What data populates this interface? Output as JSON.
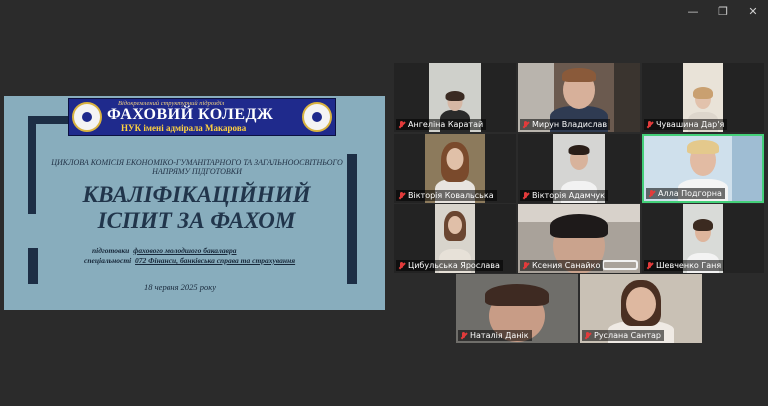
{
  "window": {
    "minimize_icon": "minimize-icon",
    "maximize_icon": "maximize-icon",
    "close_icon": "close-icon"
  },
  "slide": {
    "institution_note": "Відокремлений структурний підрозділ",
    "college_title": "ФАХОВИЙ КОЛЕДЖ",
    "university_name": "НУК імені адмірала Макарова",
    "commission": "ЦИКЛОВА КОМІСІЯ ЕКОНОМІКО-ГУМАНІТАРНОГО ТА ЗАГАЛЬНООСВІТНЬОГО НАПРЯМУ ПІДГОТОВКИ",
    "title_line1": "КВАЛІФІКАЦІЙНИЙ",
    "title_line2": "ІСПИТ ЗА ФАХОМ",
    "prep_label": "підготовки",
    "prep_value": "фахового молодшого бакалавра",
    "spec_label": "спеціальності",
    "spec_value": "072 Фінанси, банківська справа та страхування",
    "date": "18 червня 2025 року"
  },
  "participants": [
    {
      "name": "Ангеліна Каратай",
      "muted": true
    },
    {
      "name": "Мирун Владислав",
      "muted": true
    },
    {
      "name": "Чувашина Дар'я",
      "muted": true
    },
    {
      "name": "Вікторія Ковальська",
      "muted": true
    },
    {
      "name": "Вікторія Адамчук",
      "muted": true
    },
    {
      "name": "Алла Подгорна",
      "muted": true,
      "active_speaker": true
    },
    {
      "name": "Цибульська Ярослава",
      "muted": true
    },
    {
      "name": "Ксения Санайко",
      "muted": true
    },
    {
      "name": "Шевченко Ганя",
      "muted": true
    },
    {
      "name": "Наталія Данік",
      "muted": true
    },
    {
      "name": "Руслана Сантар",
      "muted": true
    }
  ],
  "colors": {
    "background": "#2b2b2b",
    "slide_bg": "#88adbd",
    "active_speaker_border": "#44d07a",
    "muted_icon": "#e23b3b"
  }
}
